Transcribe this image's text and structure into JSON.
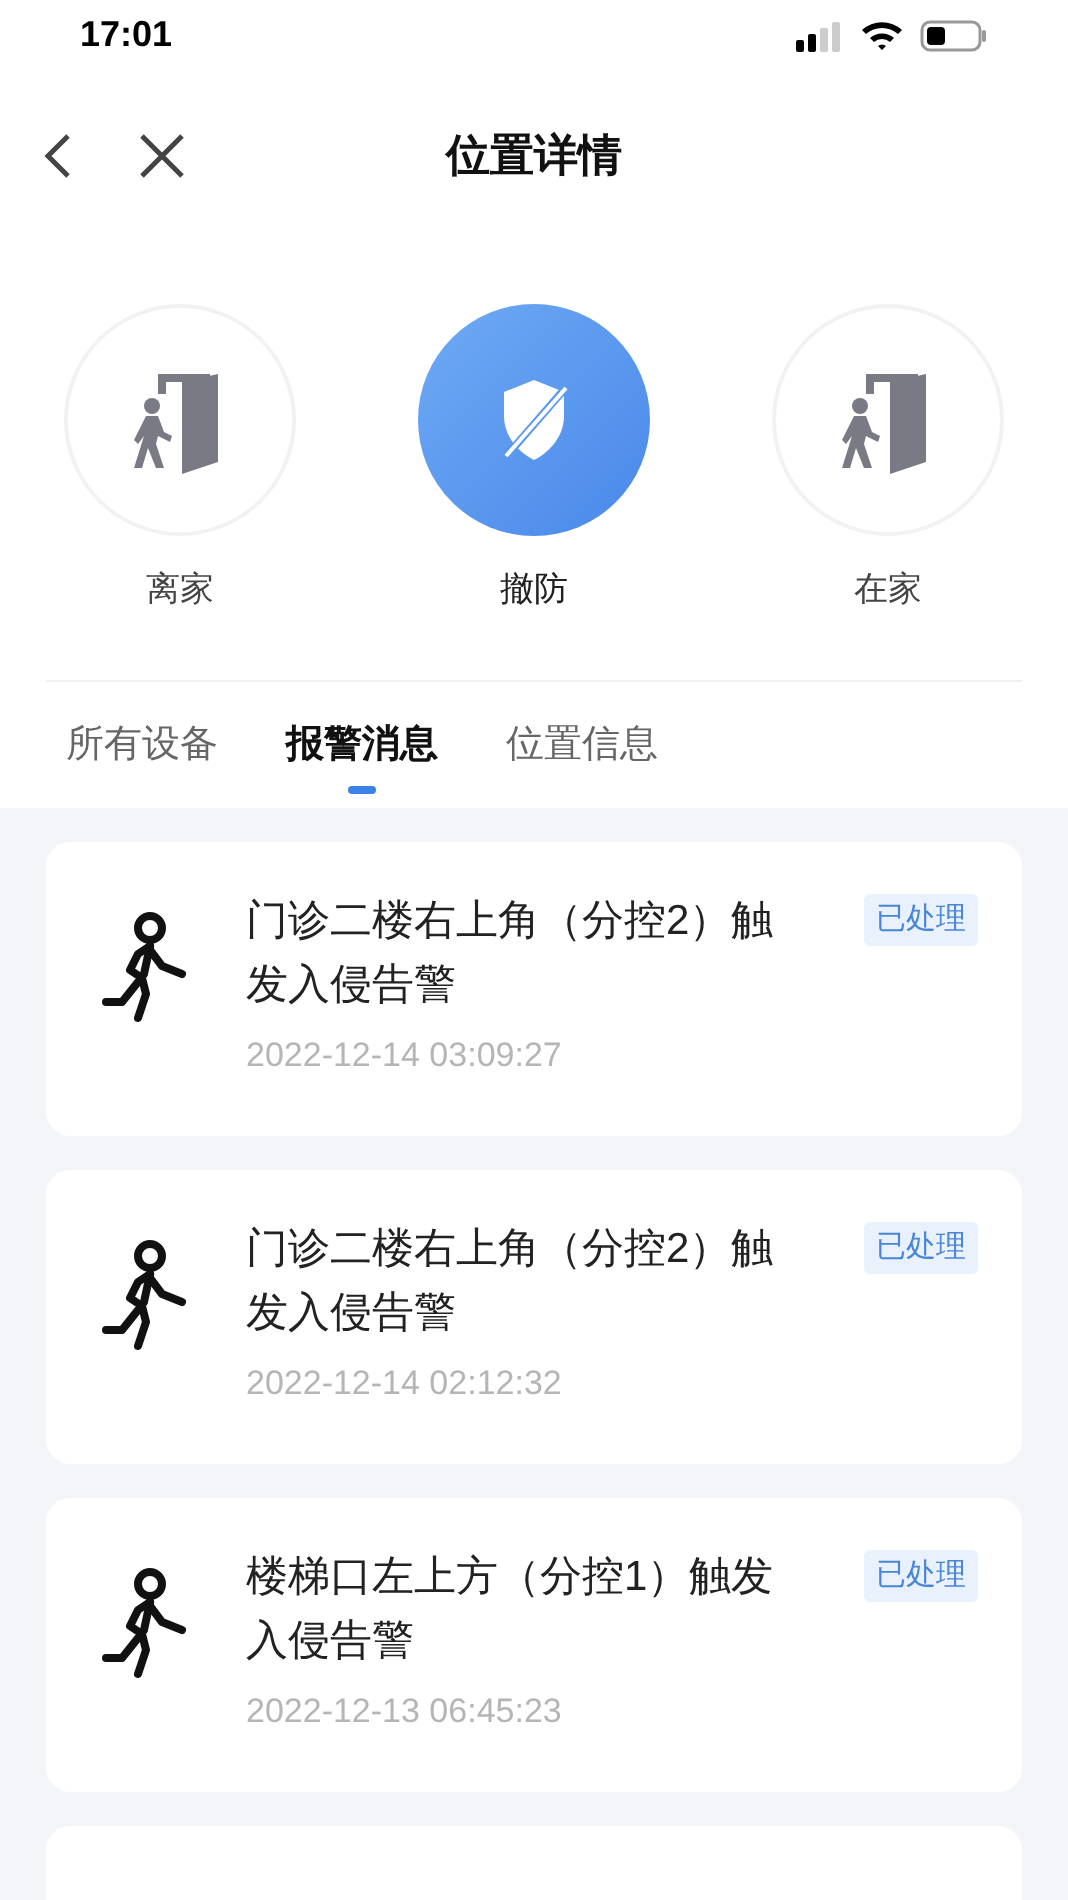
{
  "status_bar": {
    "time": "17:01"
  },
  "nav": {
    "title": "位置详情"
  },
  "modes": [
    {
      "label": "离家",
      "kind": "leave",
      "selected": false
    },
    {
      "label": "撤防",
      "kind": "disarm",
      "selected": true
    },
    {
      "label": "在家",
      "kind": "home",
      "selected": false
    }
  ],
  "tabs": [
    {
      "label": "所有设备",
      "selected": false
    },
    {
      "label": "报警消息",
      "selected": true
    },
    {
      "label": "位置信息",
      "selected": false
    }
  ],
  "alarms": [
    {
      "title": "门诊二楼右上角（分控2）触发入侵告警",
      "status": "已处理",
      "time": "2022-12-14 03:09:27"
    },
    {
      "title": "门诊二楼右上角（分控2）触发入侵告警",
      "status": "已处理",
      "time": "2022-12-14 02:12:32"
    },
    {
      "title": "楼梯口左上方（分控1）触发入侵告警",
      "status": "已处理",
      "time": "2022-12-13 06:45:23"
    }
  ]
}
